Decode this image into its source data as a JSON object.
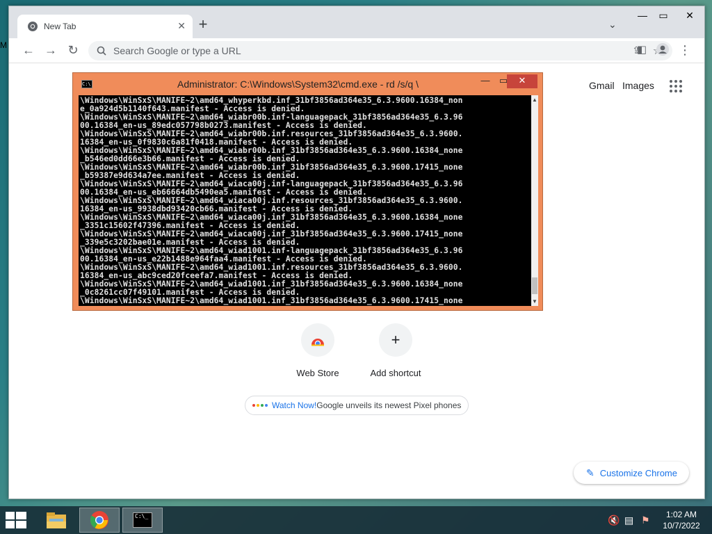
{
  "desktop": {
    "edge_text": "M"
  },
  "browser": {
    "tab": {
      "title": "New Tab"
    },
    "omnibox": {
      "placeholder": "Search Google or type a URL"
    },
    "links": {
      "gmail": "Gmail",
      "images": "Images"
    },
    "shortcuts": [
      {
        "label": "Web Store",
        "icon": "web-store-icon"
      },
      {
        "label": "Add shortcut",
        "icon": "plus-icon"
      }
    ],
    "promo": {
      "link": "Watch Now!",
      "text": " Google unveils its newest Pixel phones",
      "dot_colors": [
        "#ea4335",
        "#fbbc05",
        "#34a853",
        "#4285f4"
      ]
    },
    "customize_label": "Customize Chrome"
  },
  "cmd": {
    "title": "Administrator: C:\\Windows\\System32\\cmd.exe - rd /s/q \\",
    "icon_text": "C:\\",
    "lines": [
      "\\Windows\\WinSxS\\MANIFE~2\\amd64_whyperkbd.inf_31bf3856ad364e35_6.3.9600.16384_non",
      "e_0a924d5b1140f643.manifest - Access is denied.",
      "\\Windows\\WinSxS\\MANIFE~2\\amd64_wiabr00b.inf-languagepack_31bf3856ad364e35_6.3.96",
      "00.16384_en-us_89edc057798b0273.manifest - Access is denied.",
      "\\Windows\\WinSxS\\MANIFE~2\\amd64_wiabr00b.inf.resources_31bf3856ad364e35_6.3.9600.",
      "16384_en-us_0f9830c6a81f0418.manifest - Access is denied.",
      "\\Windows\\WinSxS\\MANIFE~2\\amd64_wiabr00b.inf_31bf3856ad364e35_6.3.9600.16384_none",
      "_b546ed0dd66e3b66.manifest - Access is denied.",
      "\\Windows\\WinSxS\\MANIFE~2\\amd64_wiabr00b.inf_31bf3856ad364e35_6.3.9600.17415_none",
      "_b59387e9d634a7ee.manifest - Access is denied.",
      "\\Windows\\WinSxS\\MANIFE~2\\amd64_wiaca00j.inf-languagepack_31bf3856ad364e35_6.3.96",
      "00.16384_en-us_eb66664db5490ea5.manifest - Access is denied.",
      "\\Windows\\WinSxS\\MANIFE~2\\amd64_wiaca00j.inf.resources_31bf3856ad364e35_6.3.9600.",
      "16384_en-us_9938dbd93420cb66.manifest - Access is denied.",
      "\\Windows\\WinSxS\\MANIFE~2\\amd64_wiaca00j.inf_31bf3856ad364e35_6.3.9600.16384_none",
      "_3351c15602f47396.manifest - Access is denied.",
      "\\Windows\\WinSxS\\MANIFE~2\\amd64_wiaca00j.inf_31bf3856ad364e35_6.3.9600.17415_none",
      "_339e5c3202bae01e.manifest - Access is denied.",
      "\\Windows\\WinSxS\\MANIFE~2\\amd64_wiad1001.inf-languagepack_31bf3856ad364e35_6.3.96",
      "00.16384_en-us_e22b1488e964faa4.manifest - Access is denied.",
      "\\Windows\\WinSxS\\MANIFE~2\\amd64_wiad1001.inf.resources_31bf3856ad364e35_6.3.9600.",
      "16384_en-us_abc9ced20fceefa7.manifest - Access is denied.",
      "\\Windows\\WinSxS\\MANIFE~2\\amd64_wiad1001.inf_31bf3856ad364e35_6.3.9600.16384_none",
      "_0c8261cc07f49101.manifest - Access is denied.",
      "\\Windows\\WinSxS\\MANIFE~2\\amd64_wiad1001.inf_31bf3856ad364e35_6.3.9600.17415_none"
    ]
  },
  "taskbar": {
    "apps": [
      {
        "name": "file-explorer",
        "icon": "folder-icon"
      },
      {
        "name": "chrome",
        "icon": "chrome-icon"
      },
      {
        "name": "cmd",
        "icon": "cmd-icon",
        "icon_text": "C:\\_"
      }
    ],
    "clock": {
      "time": "1:02 AM",
      "date": "10/7/2022"
    }
  }
}
